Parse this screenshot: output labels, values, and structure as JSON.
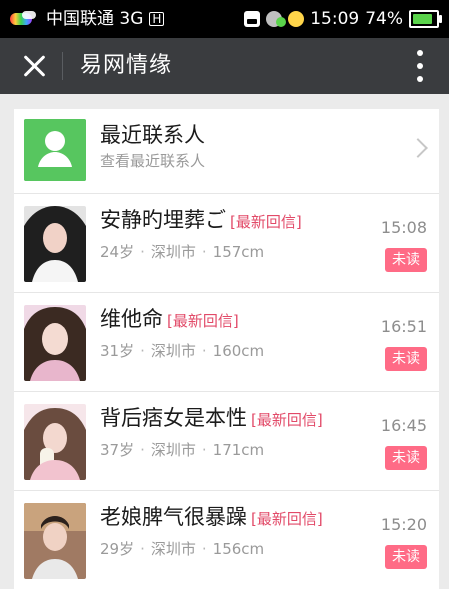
{
  "status": {
    "carrier": "中国联通 3G",
    "h": "H",
    "time": "15:09",
    "battery": "74%"
  },
  "appbar": {
    "title": "易网情缘"
  },
  "recent": {
    "title": "最近联系人",
    "subtitle": "查看最近联系人"
  },
  "items": [
    {
      "name": "安静旳埋葬ご",
      "tag": "[最新回信]",
      "age": "24岁",
      "city": "深圳市",
      "height": "157cm",
      "time": "15:08",
      "status": "未读"
    },
    {
      "name": "维他命",
      "tag": "[最新回信]",
      "age": "31岁",
      "city": "深圳市",
      "height": "160cm",
      "time": "16:51",
      "status": "未读"
    },
    {
      "name": "背后痞女是本性",
      "tag": "[最新回信]",
      "age": "37岁",
      "city": "深圳市",
      "height": "171cm",
      "time": "16:45",
      "status": "未读"
    },
    {
      "name": "老娘脾气很暴躁",
      "tag": "[最新回信]",
      "age": "29岁",
      "city": "深圳市",
      "height": "156cm",
      "time": "15:20",
      "status": "未读"
    }
  ],
  "colors": {
    "accent": "#e24a68",
    "unread_bg": "#ff6b86",
    "appbar": "#3a3c3f",
    "recent_avatar": "#57c65f"
  }
}
